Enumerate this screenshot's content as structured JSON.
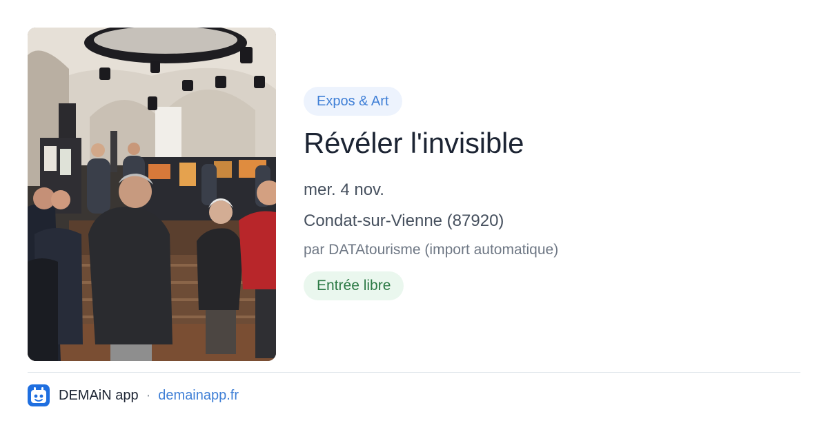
{
  "event": {
    "category": "Expos & Art",
    "title": "Révéler l'invisible",
    "date": "mer. 4 nov.",
    "location": "Condat-sur-Vienne (87920)",
    "organizer": "par DATAtourisme (import automatique)",
    "price": "Entrée libre",
    "photo_icon": "exhibition-photo"
  },
  "footer": {
    "app_name": "DEMAiN app",
    "separator": "·",
    "site": "demainapp.fr",
    "app_icon": "demain-app-icon"
  },
  "colors": {
    "accent": "#3f7fd6",
    "chip_blue_bg": "#edf3fd",
    "chip_green_bg": "#eaf7ee",
    "chip_green_text": "#2c7a45",
    "title_text": "#1c2433"
  }
}
